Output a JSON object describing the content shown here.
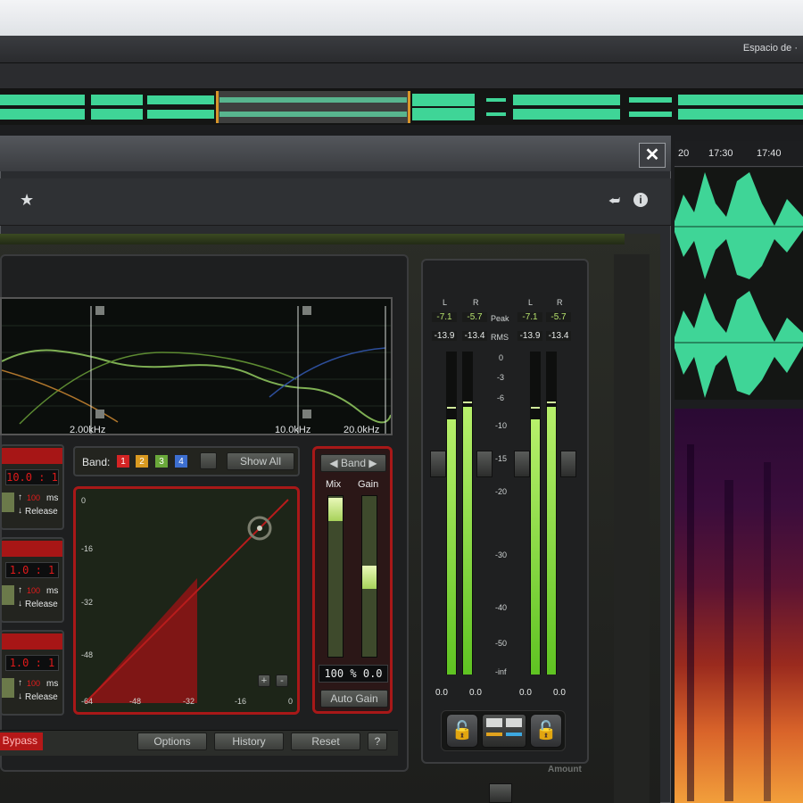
{
  "app": {
    "workspace_label": "Espacio de ·"
  },
  "timeline": {
    "ticks": [
      "20",
      "17:30",
      "17:40"
    ]
  },
  "plugin": {
    "close_glyph": "✕",
    "star_glyph": "★",
    "pin_glyph": "⮨",
    "info_glyph": "i",
    "eq_labels": [
      "2.00kHz",
      "10.0kHz",
      "20.0kHz"
    ],
    "band_label": "Band:",
    "band_buttons": [
      {
        "label": "1",
        "color": "#d42424"
      },
      {
        "label": "2",
        "color": "#d99a21"
      },
      {
        "label": "3",
        "color": "#6aa83a"
      },
      {
        "label": "4",
        "color": "#3d6fd0"
      }
    ],
    "show_all_label": "Show All",
    "band_nav": {
      "prev": "◀",
      "label": "Band",
      "next": "▶"
    },
    "mix_label": "Mix",
    "gain_label": "Gain",
    "mix_value": "100",
    "mix_unit": "%",
    "gain_value": "0.0",
    "auto_gain_label": "Auto Gain",
    "comp_rows": [
      {
        "ratio": "10.0 : 1",
        "ms_value": "100",
        "ms_unit": "ms",
        "release_label": "Release"
      },
      {
        "ratio": "1.0 : 1",
        "ms_value": "100",
        "ms_unit": "ms",
        "release_label": "Release"
      },
      {
        "ratio": "1.0 : 1",
        "ms_value": "100",
        "ms_unit": "ms",
        "release_label": "Release"
      }
    ],
    "curve_y_labels": [
      "0",
      "-16",
      "-32",
      "-48",
      "-64"
    ],
    "curve_x_labels": [
      "-48",
      "-32",
      "-16",
      "0"
    ],
    "curve_buttons": [
      "+",
      "-"
    ],
    "bottom_buttons": {
      "bypass": "Bypass",
      "options": "Options",
      "history": "History",
      "reset": "Reset",
      "help": "?"
    },
    "meter": {
      "channels": [
        "L",
        "R",
        "L",
        "R"
      ],
      "peak_label": "Peak",
      "rms_label": "RMS",
      "peak_values": [
        "-7.1",
        "-5.7",
        "-7.1",
        "-5.7"
      ],
      "rms_values": [
        "-13.9",
        "-13.4",
        "-13.9",
        "-13.4"
      ],
      "scale": [
        "0",
        "-3",
        "-6",
        "-10",
        "-15",
        "-20",
        "-30",
        "-40",
        "-50",
        "-inf"
      ],
      "bottom_values": [
        "0.0",
        "0.0",
        "0.0",
        "0.0"
      ],
      "lock_glyph": "🔓",
      "amount_label": "Amount"
    },
    "colors": {
      "waveform": "#3fd597",
      "meter_green": "#8ee24a",
      "accent_red": "#b51818"
    }
  }
}
